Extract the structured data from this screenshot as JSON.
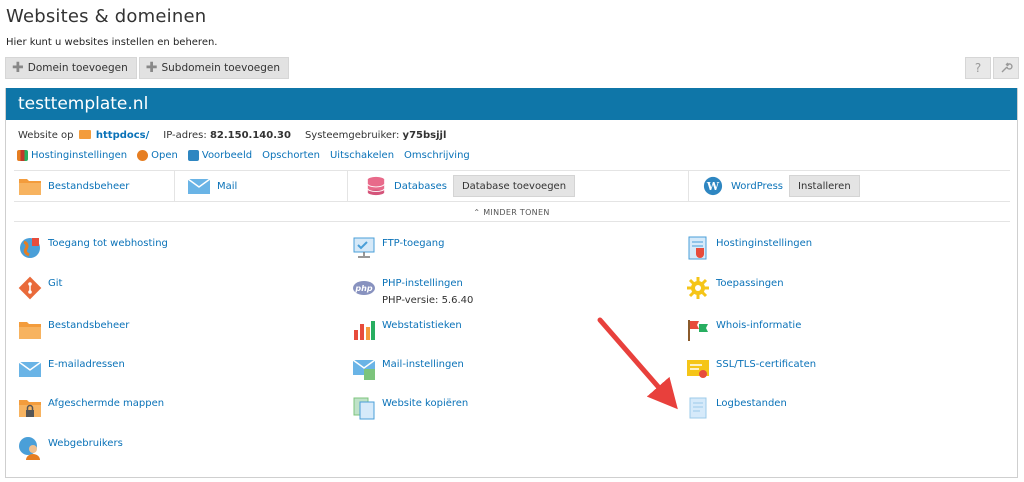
{
  "page": {
    "title": "Websites & domeinen",
    "subtitle": "Hier kunt u websites instellen en beheren."
  },
  "toolbar": {
    "add_domain": "Domein toevoegen",
    "add_subdomain": "Subdomein toevoegen"
  },
  "site": {
    "name": "testtemplate.nl",
    "website_label": "Website op",
    "docroot": "httpdocs/",
    "ip_label": "IP-adres:",
    "ip": "82.150.140.30",
    "sysuser_label": "Systeemgebruiker:",
    "sysuser": "y75bsjjl"
  },
  "actions": [
    "Hostinginstellingen",
    "Open",
    "Voorbeeld",
    "Opschorten",
    "Uitschakelen",
    "Omschrijving"
  ],
  "quick": {
    "files": "Bestandsbeheer",
    "mail": "Mail",
    "databases": "Databases",
    "add_db": "Database toevoegen",
    "wordpress": "WordPress",
    "install": "Installeren"
  },
  "less_label": "MINDER TONEN",
  "tools": {
    "col1": [
      "Toegang tot webhosting",
      "Git",
      "Bestandsbeheer",
      "E-mailadressen",
      "Afgeschermde mappen",
      "Webgebruikers"
    ],
    "col2": [
      "FTP-toegang",
      "PHP-instellingen",
      "Webstatistieken",
      "Mail-instellingen",
      "Website kopiëren"
    ],
    "php_version": "PHP-versie: 5.6.40",
    "col3": [
      "Hostinginstellingen",
      "Toepassingen",
      "Whois-informatie",
      "SSL/TLS-certificaten",
      "Logbestanden"
    ]
  },
  "colors": {
    "header_blue": "#0f76a8",
    "link_blue": "#0a72b8",
    "arrow_red": "#e8403c",
    "folder_orange": "#f39c3c"
  },
  "icons": {
    "help": "question-icon",
    "settings": "wrench-icon"
  }
}
